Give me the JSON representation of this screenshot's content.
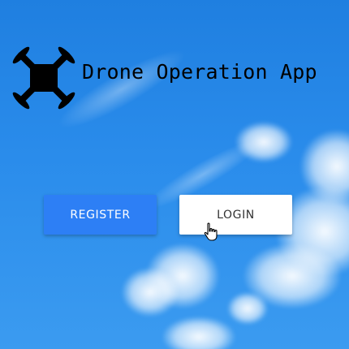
{
  "app": {
    "title": "Drone Operation App",
    "logo_icon": "drone-icon"
  },
  "actions": {
    "register_label": "REGISTER",
    "login_label": "LOGIN"
  },
  "cursor": {
    "icon": "hand-pointer-icon"
  },
  "colors": {
    "sky": "#2a8ceb",
    "register_button": "#2d7ff5",
    "login_button": "#ffffff",
    "logo": "#000000"
  }
}
